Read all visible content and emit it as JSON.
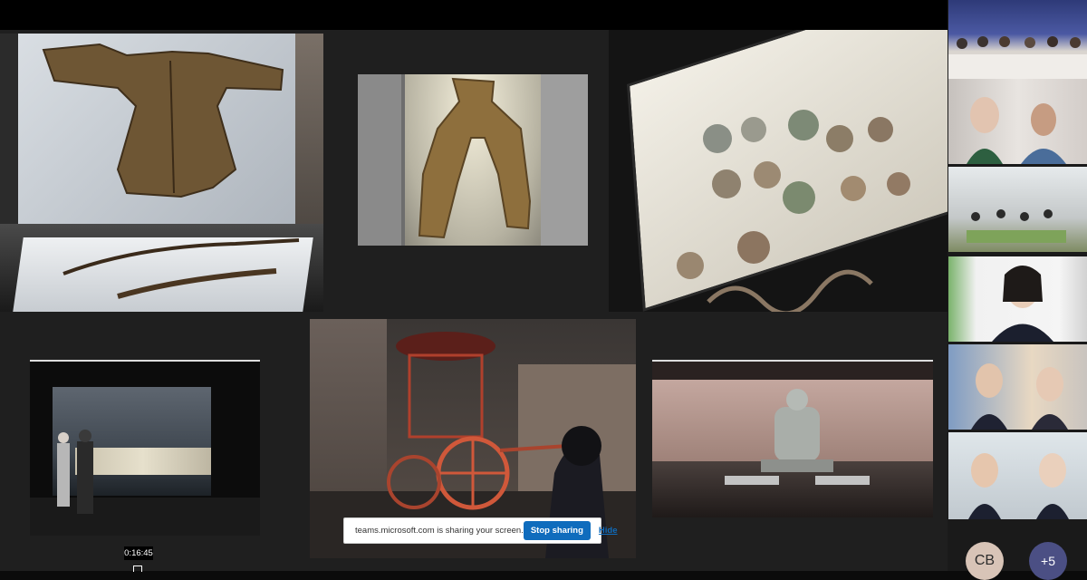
{
  "window": {
    "title": ""
  },
  "share_bar": {
    "message": "teams.microsoft.com is sharing your screen.",
    "stop_label": "Stop sharing",
    "hide_label": "Hide"
  },
  "timestamp": "0:16:45",
  "participants": {
    "avatar_initials": "CB",
    "overflow_count": "+5"
  },
  "colors": {
    "stop_button": "#0f6cbd",
    "background": "#1f1f1f",
    "avatar_cb": "#d8c4b7",
    "avatar_overflow": "#4b4f84"
  }
}
